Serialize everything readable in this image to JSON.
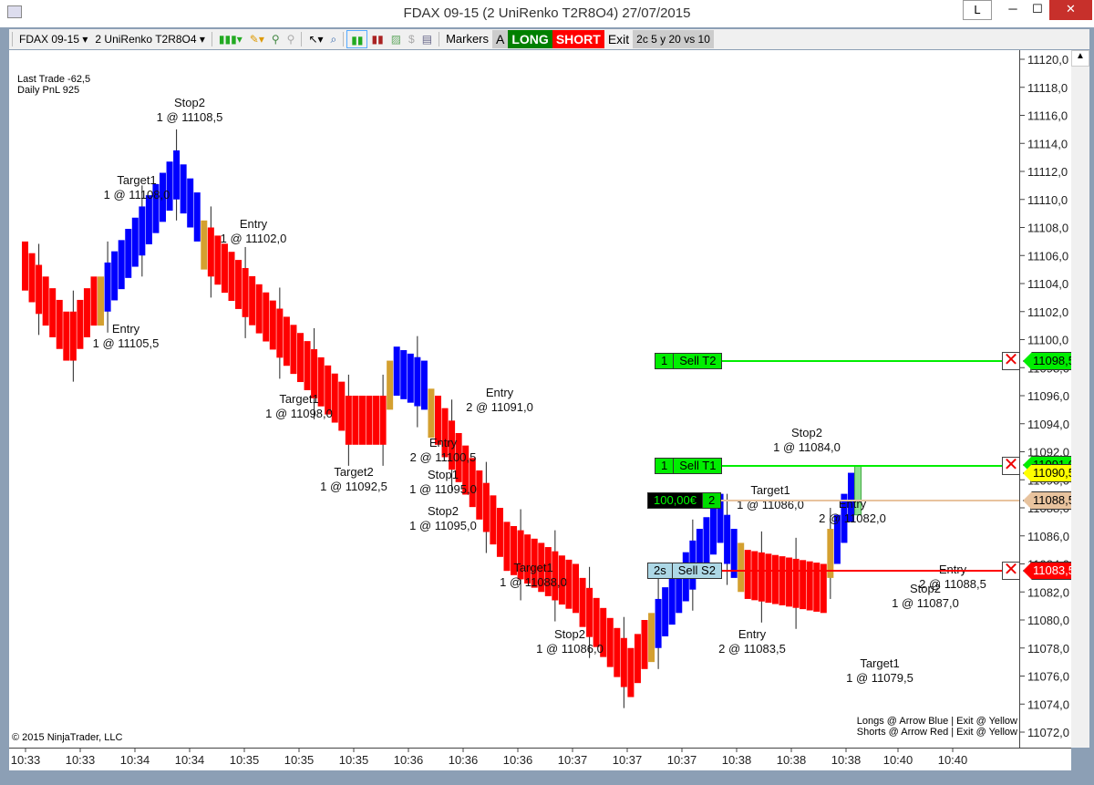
{
  "window": {
    "title": "FDAX 09-15 (2 UniRenko T2R8O4)  27/07/2015",
    "l_button": "L",
    "minimize": "─",
    "maximize": "☐",
    "close": "✕"
  },
  "toolbar": {
    "instrument": "FDAX 09-15 ▾",
    "bars": "2 UniRenko T2R8O4 ▾",
    "markers": "Markers",
    "a": "A",
    "long": "LONG",
    "short": "SHORT",
    "exit": "Exit",
    "strategy": "2c 5 y 20 vs 10"
  },
  "info": {
    "last_trade": "Last Trade -62,5",
    "daily_pnl": "Daily PnL  925"
  },
  "copyright": "© 2015 NinjaTrader, LLC",
  "legend": {
    "longs": "Longs @ Arrow  Blue | Exit @  Yellow",
    "shorts": "Shorts @ Arrow  Red | Exit @  Yellow"
  },
  "orders": [
    {
      "qty": "1",
      "label": "Sell T2",
      "price": "11098,5",
      "color": "#00ee00"
    },
    {
      "qty": "1",
      "label": "Sell T1",
      "price": "11091,0",
      "color": "#00ee00"
    },
    {
      "qty": "2s",
      "label": "Sell S2",
      "price": "11083,5",
      "color": "#add8e6"
    }
  ],
  "position": {
    "pnl": "100,00€",
    "qty": "2",
    "price": "11088,5"
  },
  "last_price": "11090,5",
  "colors": {
    "up": "#0000ff",
    "down": "#ff0000",
    "neutral": "#d4a030",
    "current": "#90e090",
    "target": "#00ee00",
    "stop": "#ff0000",
    "position": "#e8c39e"
  },
  "annotations": [
    {
      "t": "Stop2",
      "v": "1 @ 11108,5"
    },
    {
      "t": "Target1",
      "v": "1 @ 11108,0"
    },
    {
      "t": "Entry",
      "v": "1 @ 11102,0"
    },
    {
      "t": "Entry",
      "v": "1 @ 11105,5"
    },
    {
      "t": "Target1",
      "v": "1 @ 11098,0"
    },
    {
      "t": "Target2",
      "v": "1 @ 11092,5"
    },
    {
      "t": "Entry",
      "v": "2 @ 11100,5"
    },
    {
      "t": "Stop1",
      "v": "1 @ 11095,0"
    },
    {
      "t": "Stop2",
      "v": "1 @ 11095,0"
    },
    {
      "t": "Entry",
      "v": "2 @ 11091,0"
    },
    {
      "t": "Target1",
      "v": "1 @ 11088,0"
    },
    {
      "t": "Stop2",
      "v": "1 @ 11086,0"
    },
    {
      "t": "Entry",
      "v": "2 @ 11083,5"
    },
    {
      "t": "Stop2",
      "v": "1 @ 11084,0"
    },
    {
      "t": "Target1",
      "v": "1 @ 11086,0"
    },
    {
      "t": "Entry",
      "v": "2 @ 11082,0"
    },
    {
      "t": "Target1",
      "v": "1 @ 11079,5"
    },
    {
      "t": "Stop2",
      "v": "1 @ 11087,0"
    },
    {
      "t": "Entry",
      "v": "2 @ 11088,5"
    }
  ],
  "chart_data": {
    "type": "renko",
    "ylim": [
      11072,
      11120
    ],
    "yticks": [
      "11120,0",
      "11118,0",
      "11116,0",
      "11114,0",
      "11112,0",
      "11110,0",
      "11108,0",
      "11106,0",
      "11104,0",
      "11102,0",
      "11100,0",
      "11098,0",
      "11096,0",
      "11094,0",
      "11092,0",
      "11090,0",
      "11088,0",
      "11086,0",
      "11084,0",
      "11082,0",
      "11080,0",
      "11078,0",
      "11076,0",
      "11074,0",
      "11072,0"
    ],
    "xticks": [
      "10:33",
      "10:33",
      "10:34",
      "10:34",
      "10:35",
      "10:35",
      "10:35",
      "10:36",
      "10:36",
      "10:36",
      "10:37",
      "10:37",
      "10:37",
      "10:38",
      "10:38",
      "10:38",
      "10:40",
      "10:40"
    ],
    "segments": [
      {
        "n": 7,
        "from": 11105,
        "to": 11100,
        "color": "down"
      },
      {
        "n": 4,
        "from": 11100,
        "to": 11102.5,
        "color": "down"
      },
      {
        "n": 1,
        "from": 11103,
        "to": 11103,
        "color": "neutral"
      },
      {
        "n": 11,
        "from": 11104,
        "to": 11112,
        "color": "up"
      },
      {
        "n": 3,
        "from": 11111,
        "to": 11109,
        "color": "up"
      },
      {
        "n": 1,
        "from": 11107,
        "to": 11107,
        "color": "neutral"
      },
      {
        "n": 20,
        "from": 11106,
        "to": 11095,
        "color": "down"
      },
      {
        "n": 6,
        "from": 11094,
        "to": 11094,
        "color": "down"
      },
      {
        "n": 1,
        "from": 11097,
        "to": 11097,
        "color": "neutral"
      },
      {
        "n": 5,
        "from": 11098,
        "to": 11097,
        "color": "up"
      },
      {
        "n": 1,
        "from": 11095,
        "to": 11095,
        "color": "neutral"
      },
      {
        "n": 10,
        "from": 11094,
        "to": 11086,
        "color": "down"
      },
      {
        "n": 11,
        "from": 11085,
        "to": 11082,
        "color": "down"
      },
      {
        "n": 8,
        "from": 11081,
        "to": 11076,
        "color": "down"
      },
      {
        "n": 2,
        "from": 11077,
        "to": 11078,
        "color": "down"
      },
      {
        "n": 1,
        "from": 11079,
        "to": 11079,
        "color": "neutral"
      },
      {
        "n": 10,
        "from": 11080,
        "to": 11087.5,
        "color": "up"
      },
      {
        "n": 2,
        "from": 11086,
        "to": 11085,
        "color": "up"
      },
      {
        "n": 1,
        "from": 11084,
        "to": 11084,
        "color": "neutral"
      },
      {
        "n": 12,
        "from": 11083,
        "to": 11082,
        "color": "down"
      },
      {
        "n": 1,
        "from": 11085,
        "to": 11085,
        "color": "neutral"
      },
      {
        "n": 3,
        "from": 11086,
        "to": 11089,
        "color": "up"
      },
      {
        "n": 1,
        "from": 11089.5,
        "to": 11089.5,
        "color": "current"
      }
    ]
  }
}
